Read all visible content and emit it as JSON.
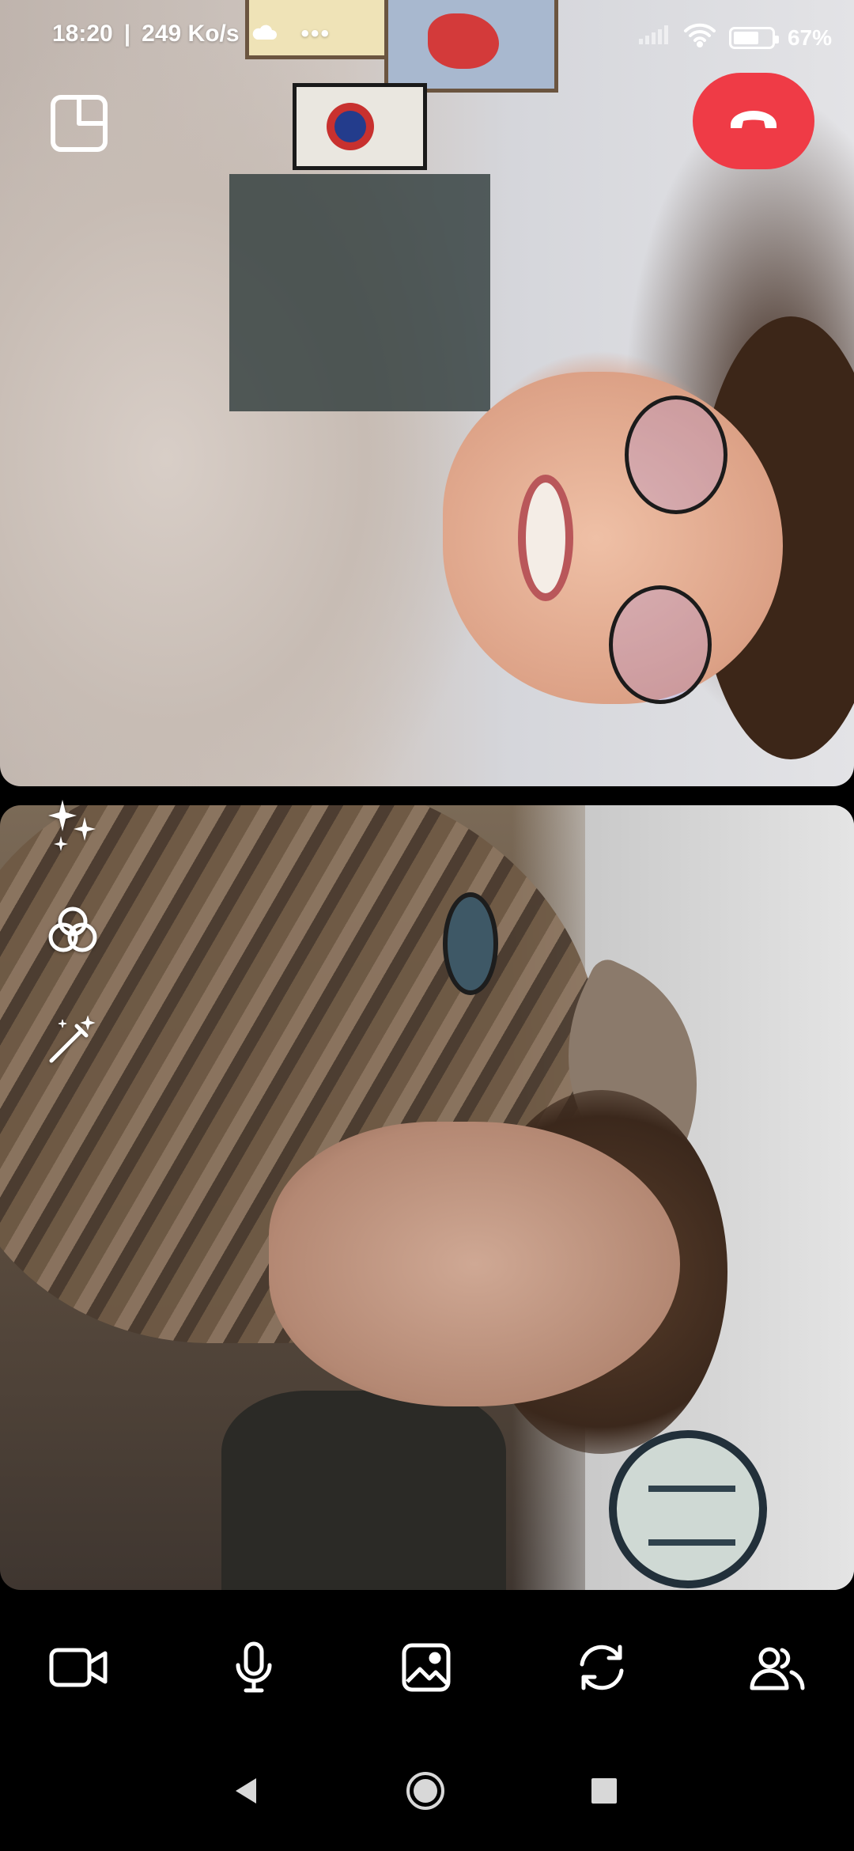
{
  "status_bar": {
    "time": "18:20",
    "separator": "|",
    "net_speed": "249 Ko/s",
    "weather_icon": "cloud-icon",
    "more": "•••",
    "signal_icon": "cellular-signal-icon",
    "wifi_icon": "wifi-icon",
    "battery_level": 0.67,
    "battery_text": "67%"
  },
  "call_controls": {
    "layout_icon": "picture-in-picture-icon",
    "end_call_icon": "phone-hangup-icon",
    "end_call_color": "#ef3b46"
  },
  "effects": [
    {
      "icon": "sparkles-icon"
    },
    {
      "icon": "color-filter-icon"
    },
    {
      "icon": "magic-wand-icon"
    }
  ],
  "toolbar": [
    {
      "icon": "video-camera-icon"
    },
    {
      "icon": "microphone-icon"
    },
    {
      "icon": "image-icon"
    },
    {
      "icon": "switch-camera-icon"
    },
    {
      "icon": "participants-icon"
    }
  ],
  "nav_bar": {
    "back_icon": "back-triangle-icon",
    "home_icon": "home-circle-icon",
    "recents_icon": "recents-square-icon"
  },
  "remote_video": {
    "sign_text": ""
  }
}
